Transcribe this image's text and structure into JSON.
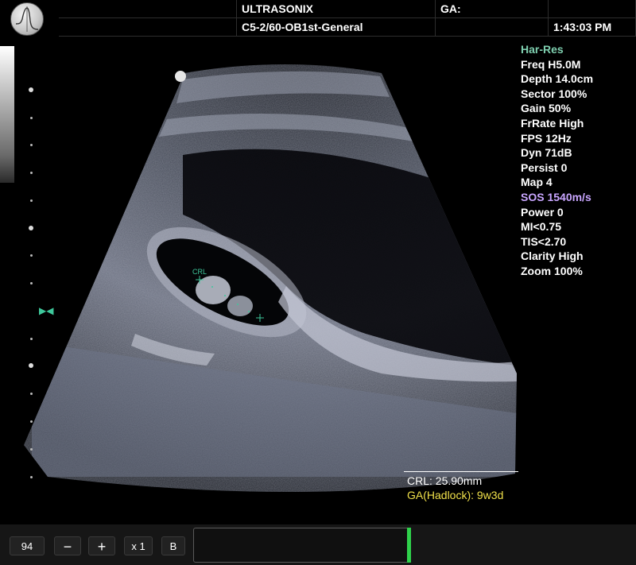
{
  "header": {
    "brand": "ULTRASONIX",
    "preset": "C5-2/60-OB1st-General",
    "ga_label": "GA:",
    "time": "1:43:03 PM",
    "logo_icon": "ultrasonix-logo-icon"
  },
  "params": [
    {
      "text": "Har-Res",
      "color": "#7fd0b0"
    },
    {
      "text": "Freq H5.0M",
      "color": "#ffffff"
    },
    {
      "text": "Depth 14.0cm",
      "color": "#ffffff"
    },
    {
      "text": "Sector 100%",
      "color": "#ffffff"
    },
    {
      "text": "Gain 50%",
      "color": "#ffffff"
    },
    {
      "text": "FrRate High",
      "color": "#ffffff"
    },
    {
      "text": "FPS 12Hz",
      "color": "#ffffff"
    },
    {
      "text": "Dyn 71dB",
      "color": "#ffffff"
    },
    {
      "text": "Persist 0",
      "color": "#ffffff"
    },
    {
      "text": "Map 4",
      "color": "#ffffff"
    },
    {
      "text": "SOS 1540m/s",
      "color": "#c9a6ff"
    },
    {
      "text": "Power 0",
      "color": "#ffffff"
    },
    {
      "text": "MI<0.75",
      "color": "#ffffff"
    },
    {
      "text": "TIS<2.70",
      "color": "#ffffff"
    },
    {
      "text": "Clarity High",
      "color": "#ffffff"
    },
    {
      "text": "Zoom 100%",
      "color": "#ffffff"
    }
  ],
  "measurement": {
    "crl": "CRL: 25.90mm",
    "ga": "GA(Hadlock): 9w3d",
    "caliper_label": "CRL"
  },
  "toolbar": {
    "value": "94",
    "minus": "−",
    "plus": "+",
    "zoom": "x 1",
    "b_mode": "B"
  },
  "colors": {
    "accent_green": "#2fd14b",
    "caliper": "#3ec79b"
  }
}
